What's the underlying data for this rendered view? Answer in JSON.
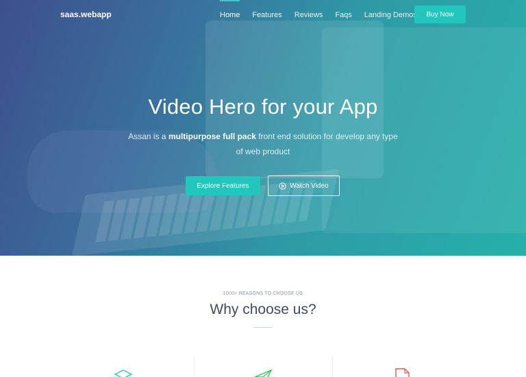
{
  "nav": {
    "brand": "saas.webapp",
    "links": [
      "Home",
      "Features",
      "Reviews",
      "Faqs",
      "Landing Demos"
    ],
    "buy_label": "Buy Now"
  },
  "hero": {
    "title": "Video Hero for your App",
    "subtitle_prefix": "Assan is a ",
    "subtitle_bold": "multipurpose full pack",
    "subtitle_suffix": " front end solution for develop any type of web product",
    "primary_label": "Explore Features",
    "secondary_label": "Watch Video"
  },
  "section": {
    "eyebrow": "1000+ REASONS TO CHOOSE US",
    "title": "Why choose us?"
  },
  "features": {
    "icons": [
      "layers-icon",
      "paper-plane-icon",
      "document-icon"
    ]
  },
  "colors": {
    "accent": "#22c6bd",
    "hero_gradient_start": "#3d4f8e",
    "hero_gradient_end": "#27b0aa",
    "heading": "#424b5a",
    "doc_icon": "#e8574a",
    "plane_icon": "#3cc463"
  }
}
